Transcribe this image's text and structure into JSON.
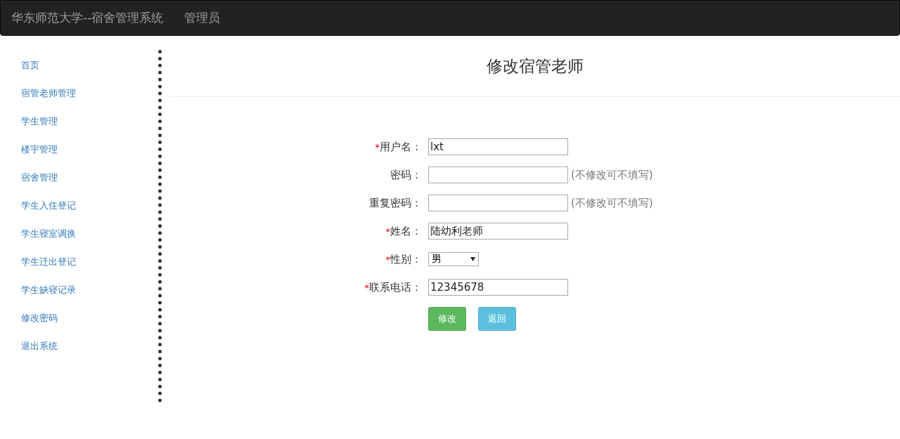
{
  "navbar": {
    "brand": "华东师范大学--宿舍管理系统",
    "user": "管理员"
  },
  "sidebar": {
    "items": [
      {
        "label": "首页"
      },
      {
        "label": "宿管老师管理"
      },
      {
        "label": "学生管理"
      },
      {
        "label": "楼宇管理"
      },
      {
        "label": "宿舍管理"
      },
      {
        "label": "学生入住登记"
      },
      {
        "label": "学生寝室调换"
      },
      {
        "label": "学生迁出登记"
      },
      {
        "label": "学生缺寝记录"
      },
      {
        "label": "修改密码"
      },
      {
        "label": "退出系统"
      }
    ]
  },
  "page": {
    "title": "修改宿管老师"
  },
  "form": {
    "fields": [
      {
        "kind": "text",
        "required_mark": "*",
        "label": "用户名：",
        "value": "lxt"
      },
      {
        "kind": "password",
        "label": "密码：",
        "hint": "(不修改可不填写)"
      },
      {
        "kind": "password",
        "label": "重复密码：",
        "hint": "(不修改可不填写)"
      },
      {
        "kind": "text",
        "required_mark": "*",
        "label": "姓名：",
        "value": "陆幼利老师"
      },
      {
        "kind": "select",
        "required_mark": "*",
        "label": "性别：",
        "value": "男"
      },
      {
        "kind": "text",
        "required_mark": "*",
        "label": "联系电话：",
        "value": "12345678"
      }
    ],
    "buttons": [
      {
        "kind": "primary",
        "label": "修改"
      },
      {
        "kind": "info",
        "label": "返回"
      }
    ]
  }
}
